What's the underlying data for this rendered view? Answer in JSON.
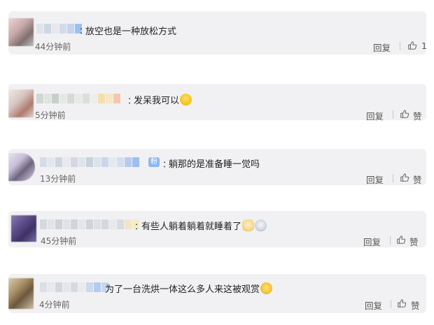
{
  "comments": [
    {
      "colon": "：",
      "text": "放空也是一种放松方式",
      "emoji": [],
      "time": "44分钟前",
      "reply": "回复",
      "like": "1"
    },
    {
      "colon": "：",
      "text": "发呆我可以",
      "emoji": [
        "laugh"
      ],
      "time": "5分钟前",
      "reply": "回复",
      "like": "赞"
    },
    {
      "colon": "：",
      "text": "躺那的是准备睡一觉吗",
      "emoji": [],
      "time": "13分钟前",
      "reply": "回复",
      "like": "赞",
      "badge": "粉"
    },
    {
      "colon": "：",
      "text": "有些人躺着躺着就睡着了",
      "emoji": [
        "cat",
        "dizzy"
      ],
      "time": "45分钟前",
      "reply": "回复",
      "like": "赞"
    },
    {
      "colon": "",
      "text": "为了一台洗烘一体这么多人来这被观赏",
      "emoji": [
        "cry"
      ],
      "time": "4分钟前",
      "reply": "回复",
      "like": "赞"
    }
  ],
  "colors": {
    "card_bg": "#f1f1f3",
    "text": "#222222",
    "meta": "#666666"
  },
  "icons": {
    "like": "thumbs-up-icon"
  }
}
